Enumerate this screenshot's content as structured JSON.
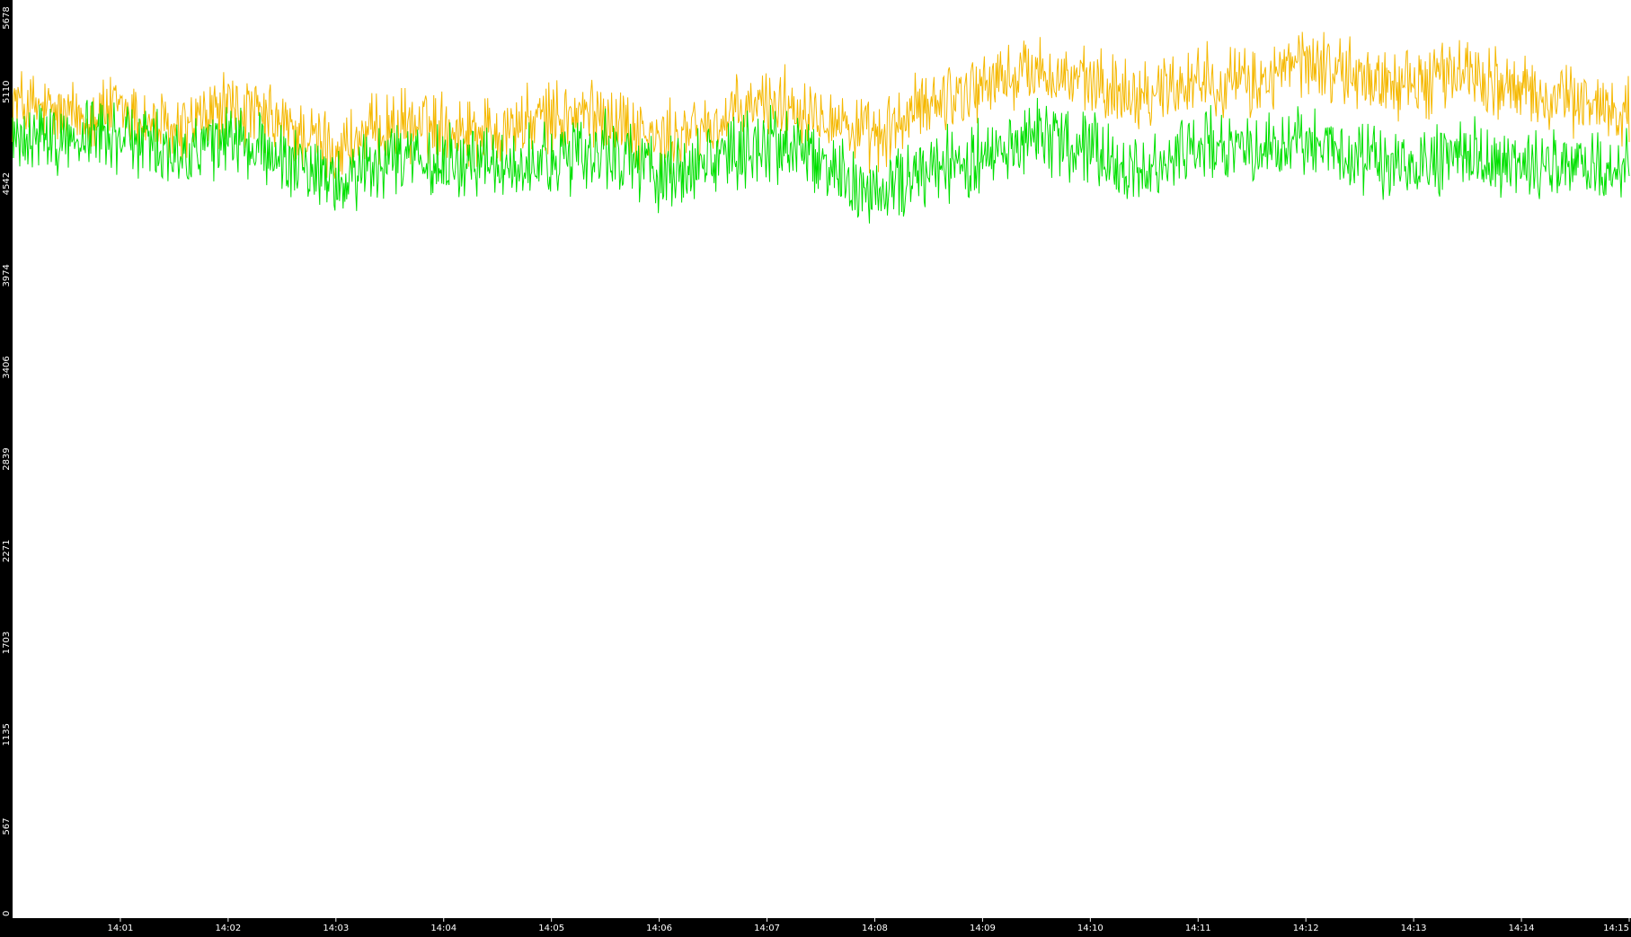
{
  "colors": {
    "background": "#000000",
    "plot_background": "#ffffff",
    "tick_text": "#ffffff",
    "series_orange": "#f5b800",
    "series_green": "#00e000"
  },
  "chart_data": {
    "type": "line",
    "title": "",
    "xlabel": "",
    "ylabel": "",
    "grid": false,
    "legend": "none",
    "ylim": [
      0,
      5678
    ],
    "y_ticks": [
      "0",
      "567",
      "1135",
      "1703",
      "2271",
      "2839",
      "3406",
      "3974",
      "4542",
      "5110",
      "5678"
    ],
    "x_ticks": [
      "14:01",
      "14:02",
      "14:03",
      "14:04",
      "14:05",
      "14:06",
      "14:07",
      "14:08",
      "14:09",
      "14:10",
      "14:11",
      "14:12",
      "14:13",
      "14:14",
      "14:15"
    ],
    "x_tick_minutes": [
      1,
      2,
      3,
      4,
      5,
      6,
      7,
      8,
      9,
      10,
      11,
      12,
      13,
      14,
      15
    ],
    "x_range_minutes": [
      0,
      15
    ],
    "x": [
      0,
      0.5,
      1,
      1.5,
      2,
      2.5,
      3,
      3.5,
      4,
      4.5,
      5,
      5.5,
      6,
      6.5,
      7,
      7.5,
      8,
      8.5,
      9,
      9.5,
      10,
      10.5,
      11,
      11.5,
      12,
      12.5,
      13,
      13.5,
      14,
      14.5,
      15
    ],
    "series": [
      {
        "color": "#f5b800",
        "values": [
          5050,
          4950,
          5000,
          4850,
          5020,
          4900,
          4750,
          4900,
          4900,
          4870,
          4950,
          4980,
          4800,
          4900,
          5050,
          5000,
          4800,
          5050,
          5150,
          5250,
          5150,
          5100,
          5200,
          5150,
          5300,
          5200,
          5150,
          5250,
          5100,
          5050,
          5000
        ]
      },
      {
        "color": "#00e000",
        "values": [
          4850,
          4800,
          4850,
          4700,
          4800,
          4700,
          4550,
          4700,
          4700,
          4650,
          4700,
          4750,
          4600,
          4700,
          4800,
          4700,
          4450,
          4650,
          4700,
          4850,
          4750,
          4600,
          4800,
          4750,
          4800,
          4700,
          4650,
          4750,
          4650,
          4650,
          4650
        ]
      }
    ]
  }
}
